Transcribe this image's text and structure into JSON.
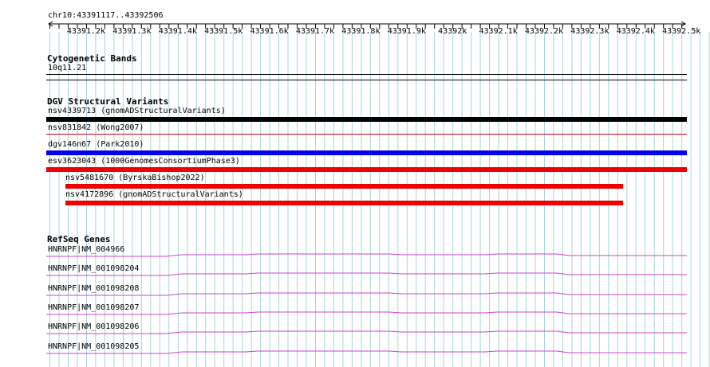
{
  "locus": "chr10:43391117..43392506",
  "ruler": {
    "ticks": [
      "43391.2k",
      "43391.3k",
      "43391.4k",
      "43391.5k",
      "43391.6k",
      "43391.7k",
      "43391.8k",
      "43391.9k",
      "43392k",
      "43392.1k",
      "43392.2k",
      "43392.3k",
      "43392.4k",
      "43392.5k"
    ]
  },
  "tracks": {
    "cytoband": {
      "title": "Cytogenetic Bands",
      "band": "10q11.21"
    },
    "dgv": {
      "title": "DGV Structural Variants",
      "features": [
        {
          "label": "nsv4339713 (gnomADStructuralVariants)",
          "color": "#000000"
        },
        {
          "label": "nsv831842 (Wong2007)",
          "color": "#cc0000"
        },
        {
          "label": "dgv146n67 (Park2010)",
          "color": "#0000ee"
        },
        {
          "label": "esv3623043 (1000GenomesConsortiumPhase3)",
          "color": "#ee0000"
        },
        {
          "label": "nsv5481670 (ByrskaBishop2022)",
          "color": "#ee0000"
        },
        {
          "label": "nsv4172896 (gnomADStructuralVariants)",
          "color": "#ee0000"
        }
      ]
    },
    "refseq": {
      "title": "RefSeq Genes",
      "color": "#cc44cc",
      "transcripts": [
        {
          "label": "HNRNPF|NM_004966"
        },
        {
          "label": "HNRNPF|NM_001098204"
        },
        {
          "label": "HNRNPF|NM_001098208"
        },
        {
          "label": "HNRNPF|NM_001098207"
        },
        {
          "label": "HNRNPF|NM_001098206"
        },
        {
          "label": "HNRNPF|NM_001098205"
        }
      ]
    }
  }
}
